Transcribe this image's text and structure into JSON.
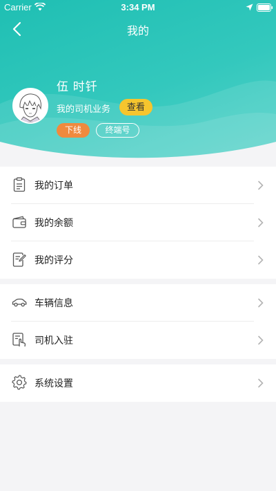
{
  "status_bar": {
    "carrier": "Carrier",
    "time": "3:34 PM"
  },
  "nav": {
    "title": "我的"
  },
  "profile": {
    "name": "伍 时钎",
    "business_label": "我的司机业务",
    "view_button": "查看",
    "status_tag": "下线",
    "terminal_tag": "终端号"
  },
  "menu": {
    "group1": [
      {
        "label": "我的订单",
        "icon": "clipboard-icon"
      },
      {
        "label": "我的余额",
        "icon": "wallet-icon"
      },
      {
        "label": "我的评分",
        "icon": "edit-note-icon"
      }
    ],
    "group2": [
      {
        "label": "车辆信息",
        "icon": "car-icon"
      },
      {
        "label": "司机入驻",
        "icon": "tap-card-icon"
      }
    ],
    "group3": [
      {
        "label": "系统设置",
        "icon": "gear-icon"
      }
    ]
  },
  "colors": {
    "header_teal": "#2cc4b8",
    "view_button": "#f6c52e",
    "offline_tag": "#f08a3e",
    "background": "#f4f4f6"
  }
}
